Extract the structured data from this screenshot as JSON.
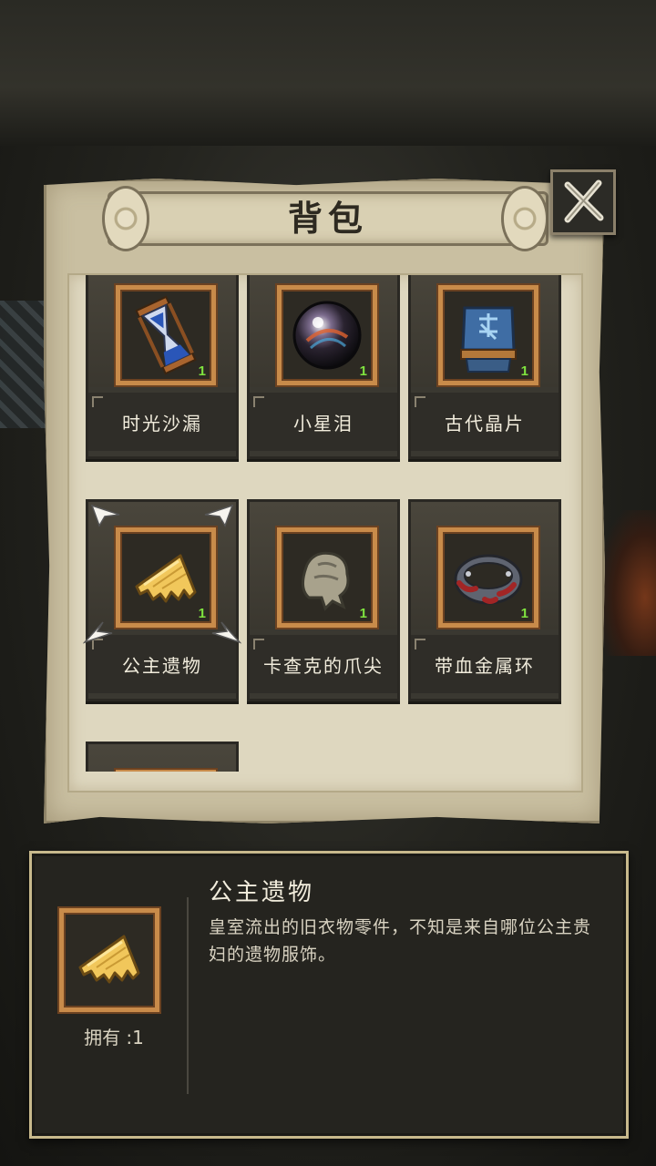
{
  "header": {
    "title": "背包"
  },
  "close": {
    "icon": "close-x-icon"
  },
  "inventory": {
    "items": [
      {
        "name": "时光沙漏",
        "count": "1",
        "icon": "hourglass-icon"
      },
      {
        "name": "小星泪",
        "count": "1",
        "icon": "star-orb-icon"
      },
      {
        "name": "古代晶片",
        "count": "1",
        "icon": "ancient-crystal-icon"
      },
      {
        "name": "公主遗物",
        "count": "1",
        "icon": "cloth-scrap-icon",
        "selected": true
      },
      {
        "name": "卡查克的爪尖",
        "count": "1",
        "icon": "claw-icon"
      },
      {
        "name": "带血金属环",
        "count": "1",
        "icon": "bloody-ring-icon"
      },
      {
        "name": "",
        "count": "",
        "icon": "unknown-item-icon"
      }
    ]
  },
  "detail": {
    "name": "公主遗物",
    "owned_label": "拥有 :1",
    "description": "皇室流出的旧衣物零件，不知是来自哪位公主贵妇的遗物服饰。",
    "icon": "cloth-scrap-icon"
  },
  "colors": {
    "parchment": "#c9bfa1",
    "frame_gold": "#c88b4a",
    "count_green": "#7fe33f",
    "detail_border": "#c8b98c"
  }
}
